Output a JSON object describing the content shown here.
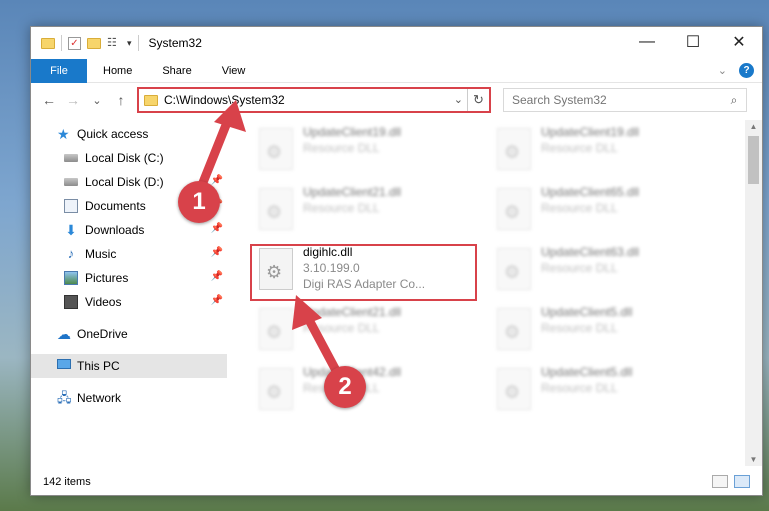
{
  "window": {
    "title": "System32",
    "controls": {
      "minimize": "—",
      "maximize": "☐",
      "close": "✕"
    }
  },
  "ribbon": {
    "tabs": [
      "File",
      "Home",
      "Share",
      "View"
    ],
    "help": "?"
  },
  "nav": {
    "back": "←",
    "forward": "→",
    "recent": "⌄",
    "up": "↑",
    "address": "C:\\Windows\\System32",
    "search_placeholder": "Search System32"
  },
  "sidebar": {
    "quick_access": "Quick access",
    "items": [
      {
        "label": "Local Disk (C:)",
        "icon": "drive-icon",
        "pinned": false
      },
      {
        "label": "Local Disk (D:)",
        "icon": "drive-icon",
        "pinned": true
      },
      {
        "label": "Documents",
        "icon": "documents-icon",
        "pinned": true
      },
      {
        "label": "Downloads",
        "icon": "downloads-icon",
        "pinned": true
      },
      {
        "label": "Music",
        "icon": "music-icon",
        "pinned": true
      },
      {
        "label": "Pictures",
        "icon": "pictures-icon",
        "pinned": true
      },
      {
        "label": "Videos",
        "icon": "videos-icon",
        "pinned": true
      }
    ],
    "onedrive": "OneDrive",
    "this_pc": "This PC",
    "network": "Network"
  },
  "files": [
    {
      "name": "UpdateClient19.dll",
      "meta": "Resource DLL",
      "blurred": true
    },
    {
      "name": "UpdateClient19.dll",
      "meta": "Resource DLL",
      "blurred": true
    },
    {
      "name": "UpdateClient21.dll",
      "meta": "Resource DLL",
      "blurred": true
    },
    {
      "name": "UpdateClient65.dll",
      "meta": "Resource DLL",
      "blurred": true
    },
    {
      "name": "digihlc.dll",
      "meta": "3.10.199.0",
      "meta2": "Digi RAS Adapter Co...",
      "blurred": false
    },
    {
      "name": "UpdateClient63.dll",
      "meta": "Resource DLL",
      "blurred": true
    },
    {
      "name": "UpdateClient21.dll",
      "meta": "Resource DLL",
      "blurred": true
    },
    {
      "name": "UpdateClient5.dll",
      "meta": "Resource DLL",
      "blurred": true
    },
    {
      "name": "UpdateClient42.dll",
      "meta": "Resource DLL",
      "blurred": true
    },
    {
      "name": "UpdateClient5.dll",
      "meta": "Resource DLL",
      "blurred": true
    }
  ],
  "status": {
    "item_count": "142 items"
  },
  "annotations": {
    "step1": "1",
    "step2": "2",
    "color": "#d8424a"
  }
}
